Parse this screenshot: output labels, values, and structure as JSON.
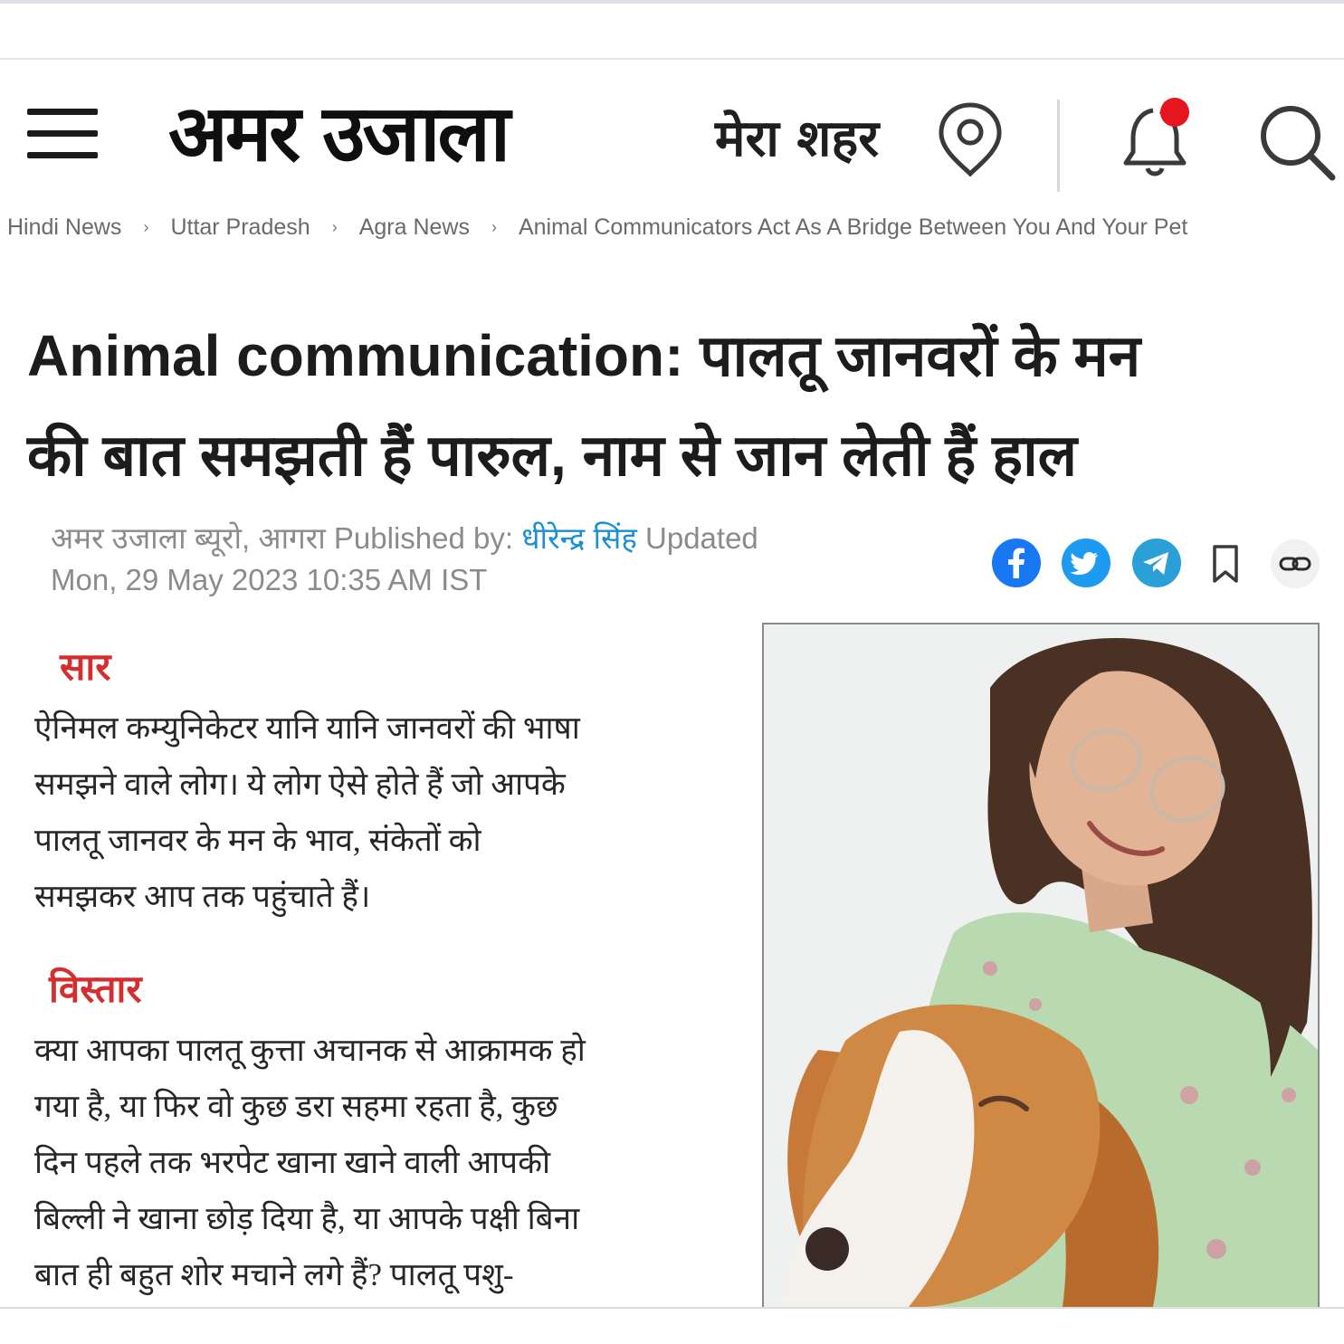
{
  "header": {
    "logo_text": "अमर उजाला",
    "city_label": "मेरा शहर",
    "icons": {
      "menu": "menu-icon",
      "location": "location-pin-icon",
      "notification": "bell-icon",
      "search": "search-icon"
    },
    "notification_dot_color": "#e5161d"
  },
  "breadcrumb": {
    "items": [
      {
        "label": "Hindi News"
      },
      {
        "label": "Uttar Pradesh"
      },
      {
        "label": "Agra News"
      },
      {
        "label": "Animal Communicators Act As A Bridge Between You And Your Pet"
      }
    ],
    "separator": "›"
  },
  "article": {
    "headline_line1": "Animal communication: पालतू जानवरों के मन",
    "headline_line2": "की बात समझती हैं पारुल, नाम से जान लेती हैं हाल",
    "meta": {
      "bureau": "अमर उजाला ब्यूरो, आगरा",
      "published_by_label": "Published by:",
      "author": "धीरेन्द्र सिंह",
      "updated_label": "Updated",
      "updated_datetime": "Mon, 29 May 2023 10:35 AM IST"
    },
    "share": {
      "icons": [
        "facebook-icon",
        "twitter-icon",
        "telegram-icon",
        "bookmark-icon",
        "link-icon"
      ],
      "colors": {
        "facebook": "#1877f2",
        "twitter": "#1d9bf0",
        "telegram": "#2a9fd8"
      }
    },
    "summary": {
      "title": "सार",
      "lines": [
        "ऐनिमल कम्युनिकेटर यानि यानि जानवरों की भाषा",
        "समझने वाले लोग। ये लोग ऐसे होते हैं जो  आपके",
        "पालतू जानवर के मन के भाव, संकेतों को",
        "समझकर आप तक पहुंचाते हैं।"
      ]
    },
    "detail": {
      "title": "विस्तार",
      "lines": [
        "क्या आपका पालतू कुत्ता अचानक से आक्रामक हो",
        "गया है, या फिर वो कुछ डरा सहमा रहता है, कुछ",
        "दिन पहले तक भरपेट खाना खाने वाली आपकी",
        "बिल्ली ने खाना छोड़ दिया है, या आपके पक्षी बिना",
        "बात ही बहुत शोर मचाने लगे हैं? पालतू पशु-"
      ]
    },
    "accent_color": "#d32f2f",
    "author_color": "#1a8fd6"
  }
}
